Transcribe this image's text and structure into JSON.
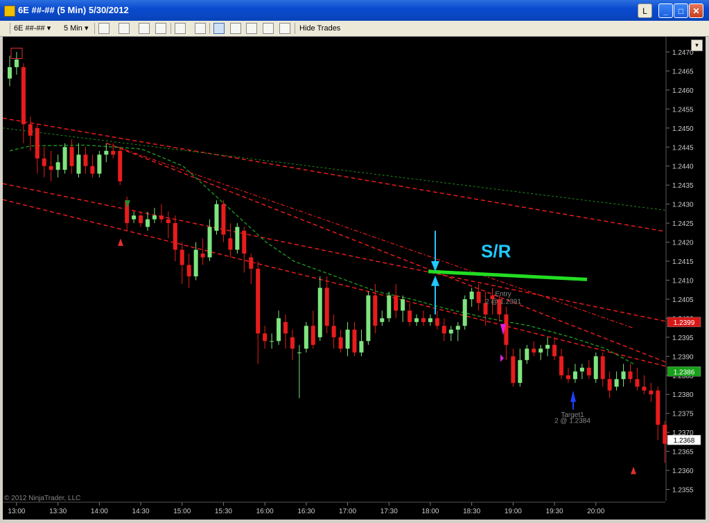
{
  "window": {
    "title": "6E ##-## (5 Min)  5/30/2012",
    "btn_l": "L",
    "btn_min": "_",
    "btn_max": "□",
    "btn_close": "✕"
  },
  "toolbar": {
    "instrument": "6E ##-##",
    "interval": "5 Min",
    "dropdown_glyph": "▾",
    "hide_trades_label": "Hide Trades",
    "icons": [
      "bar-type-icon",
      "draw-pencil-icon",
      "indicator-add-icon",
      "strategy-icon",
      "cursor-icon",
      "zoom-icon",
      "chart-trader-icon",
      "data-box-icon",
      "properties-icon",
      "alert-icon",
      "hide-icon"
    ]
  },
  "chart_data": {
    "type": "candlestick",
    "title": "",
    "ylim": [
      1.2352,
      1.2474
    ],
    "y_ticks": [
      "1.2470",
      "1.2465",
      "1.2460",
      "1.2455",
      "1.2450",
      "1.2445",
      "1.2440",
      "1.2435",
      "1.2430",
      "1.2425",
      "1.2420",
      "1.2415",
      "1.2410",
      "1.2405",
      "1.2400",
      "1.2395",
      "1.2390",
      "1.2385",
      "1.2380",
      "1.2375",
      "1.2370",
      "1.2365",
      "1.2360",
      "1.2355"
    ],
    "x_ticks": [
      "13:00",
      "13:30",
      "14:00",
      "14:30",
      "15:00",
      "15:30",
      "16:00",
      "16:30",
      "17:00",
      "17:30",
      "18:00",
      "18:30",
      "19:00",
      "19:30",
      "20:00"
    ],
    "x_start": "12:55",
    "bar_minutes": 5,
    "candles": [
      [
        1.2463,
        1.2469,
        1.2461,
        1.2466
      ],
      [
        1.2466,
        1.247,
        1.2464,
        1.2468
      ],
      [
        1.2466,
        1.2467,
        1.2446,
        1.2451
      ],
      [
        1.2451,
        1.2453,
        1.2444,
        1.2448
      ],
      [
        1.245,
        1.2451,
        1.2438,
        1.2442
      ],
      [
        1.2442,
        1.2445,
        1.2437,
        1.244
      ],
      [
        1.244,
        1.2444,
        1.2436,
        1.2439
      ],
      [
        1.2439,
        1.2443,
        1.2437,
        1.2441
      ],
      [
        1.2439,
        1.2446,
        1.2438,
        1.2445
      ],
      [
        1.2445,
        1.2447,
        1.2438,
        1.244
      ],
      [
        1.2438,
        1.2446,
        1.2437,
        1.2443
      ],
      [
        1.2443,
        1.2445,
        1.2438,
        1.244
      ],
      [
        1.244,
        1.2443,
        1.2437,
        1.2438
      ],
      [
        1.2438,
        1.2444,
        1.2437,
        1.2443
      ],
      [
        1.2443,
        1.2446,
        1.2441,
        1.2444
      ],
      [
        1.2444,
        1.2446,
        1.2442,
        1.2443
      ],
      [
        1.2444,
        1.2445,
        1.2435,
        1.2436
      ],
      [
        1.2431,
        1.2432,
        1.2423,
        1.2425
      ],
      [
        1.2426,
        1.2428,
        1.2425,
        1.2427
      ],
      [
        1.2427,
        1.2428,
        1.2424,
        1.2425
      ],
      [
        1.2424,
        1.2428,
        1.2423,
        1.2426
      ],
      [
        1.2426,
        1.2429,
        1.2425,
        1.2427
      ],
      [
        1.2427,
        1.243,
        1.2425,
        1.2426
      ],
      [
        1.2426,
        1.2428,
        1.2421,
        1.2425
      ],
      [
        1.2425,
        1.2427,
        1.2415,
        1.2418
      ],
      [
        1.2418,
        1.242,
        1.2409,
        1.2414
      ],
      [
        1.2414,
        1.2417,
        1.2408,
        1.2411
      ],
      [
        1.2411,
        1.242,
        1.241,
        1.2418
      ],
      [
        1.2417,
        1.2421,
        1.2414,
        1.2416
      ],
      [
        1.2416,
        1.2426,
        1.2415,
        1.2424
      ],
      [
        1.2423,
        1.2431,
        1.2422,
        1.243
      ],
      [
        1.243,
        1.2431,
        1.242,
        1.2422
      ],
      [
        1.2421,
        1.2425,
        1.2416,
        1.2418
      ],
      [
        1.2418,
        1.2425,
        1.2417,
        1.2424
      ],
      [
        1.2423,
        1.2424,
        1.2412,
        1.2417
      ],
      [
        1.2416,
        1.2417,
        1.2409,
        1.2413
      ],
      [
        1.2413,
        1.2415,
        1.2388,
        1.2396
      ],
      [
        1.2396,
        1.2398,
        1.2392,
        1.2394
      ],
      [
        1.2394,
        1.2396,
        1.2392,
        1.2394
      ],
      [
        1.2394,
        1.2402,
        1.2393,
        1.24
      ],
      [
        1.2399,
        1.2401,
        1.2392,
        1.2396
      ],
      [
        1.2395,
        1.2397,
        1.2389,
        1.2392
      ],
      [
        1.2391,
        1.2393,
        1.2379,
        1.2391
      ],
      [
        1.2392,
        1.2399,
        1.2391,
        1.2398
      ],
      [
        1.2398,
        1.2402,
        1.2392,
        1.2393
      ],
      [
        1.2395,
        1.2411,
        1.2394,
        1.2408
      ],
      [
        1.2408,
        1.2411,
        1.2396,
        1.2398
      ],
      [
        1.2398,
        1.2401,
        1.2392,
        1.2395
      ],
      [
        1.2395,
        1.2397,
        1.2391,
        1.2392
      ],
      [
        1.2392,
        1.2399,
        1.239,
        1.2397
      ],
      [
        1.2397,
        1.2399,
        1.239,
        1.2391
      ],
      [
        1.2391,
        1.2397,
        1.239,
        1.2394
      ],
      [
        1.2394,
        1.2407,
        1.2393,
        1.2406
      ],
      [
        1.2406,
        1.2409,
        1.2396,
        1.2398
      ],
      [
        1.2399,
        1.2402,
        1.2398,
        1.24
      ],
      [
        1.24,
        1.2407,
        1.2399,
        1.2406
      ],
      [
        1.2406,
        1.2409,
        1.24,
        1.2402
      ],
      [
        1.2402,
        1.2406,
        1.2399,
        1.2405
      ],
      [
        1.2402,
        1.2404,
        1.2398,
        1.2399
      ],
      [
        1.2399,
        1.2401,
        1.2398,
        1.24
      ],
      [
        1.24,
        1.2402,
        1.2398,
        1.2399
      ],
      [
        1.2399,
        1.2401,
        1.2398,
        1.24
      ],
      [
        1.24,
        1.2402,
        1.2397,
        1.2398
      ],
      [
        1.2398,
        1.24,
        1.2394,
        1.2396
      ],
      [
        1.2396,
        1.2398,
        1.2394,
        1.2397
      ],
      [
        1.2397,
        1.2399,
        1.2394,
        1.2398
      ],
      [
        1.2398,
        1.2406,
        1.2397,
        1.2405
      ],
      [
        1.2405,
        1.2408,
        1.2403,
        1.2407
      ],
      [
        1.2407,
        1.2409,
        1.2402,
        1.2404
      ],
      [
        1.2404,
        1.2407,
        1.2398,
        1.2401
      ],
      [
        1.2406,
        1.2408,
        1.2401,
        1.2405
      ],
      [
        1.2405,
        1.2406,
        1.2399,
        1.2401
      ],
      [
        1.2401,
        1.2403,
        1.2389,
        1.2393
      ],
      [
        1.239,
        1.2392,
        1.2382,
        1.2383
      ],
      [
        1.2383,
        1.2392,
        1.2382,
        1.2389
      ],
      [
        1.2389,
        1.2393,
        1.2388,
        1.2392
      ],
      [
        1.2392,
        1.2394,
        1.239,
        1.2391
      ],
      [
        1.2391,
        1.2393,
        1.2389,
        1.2392
      ],
      [
        1.2392,
        1.2395,
        1.239,
        1.2393
      ],
      [
        1.2393,
        1.2395,
        1.2389,
        1.239
      ],
      [
        1.239,
        1.2392,
        1.2384,
        1.2385
      ],
      [
        1.2385,
        1.2387,
        1.2383,
        1.2384
      ],
      [
        1.2384,
        1.2388,
        1.2383,
        1.2386
      ],
      [
        1.2386,
        1.2388,
        1.2384,
        1.2387
      ],
      [
        1.2387,
        1.2389,
        1.2384,
        1.2385
      ],
      [
        1.2384,
        1.2391,
        1.2383,
        1.239
      ],
      [
        1.239,
        1.2391,
        1.2382,
        1.2384
      ],
      [
        1.2384,
        1.2386,
        1.2379,
        1.2381
      ],
      [
        1.2382,
        1.2386,
        1.2381,
        1.2384
      ],
      [
        1.2384,
        1.2388,
        1.2382,
        1.2386
      ],
      [
        1.2386,
        1.2388,
        1.2383,
        1.2384
      ],
      [
        1.2384,
        1.2387,
        1.2381,
        1.2382
      ],
      [
        1.2382,
        1.2385,
        1.238,
        1.2381
      ],
      [
        1.2381,
        1.2383,
        1.2378,
        1.238
      ],
      [
        1.2381,
        1.2382,
        1.2368,
        1.2372
      ],
      [
        1.2372,
        1.2373,
        1.2362,
        1.2367
      ]
    ],
    "price_marker_red": "1.2399",
    "price_marker_green": "1.2386",
    "price_marker_last": "1.2368",
    "annotations": {
      "sr_label": "S/R",
      "entry_label": "Entry",
      "entry_detail": "2 @ 1.2391",
      "target_label": "Target1",
      "target_detail": "2 @ 1.2384"
    },
    "copyright": "© 2012 NinjaTrader, LLC",
    "colors": {
      "up": "#7fe47f",
      "down": "#e81c1c",
      "trend": "#e81c1c",
      "ma": "#1e8a1e",
      "sr": "#22dd22",
      "sr_text": "#20c8ff",
      "arrow": "#20c8ff"
    }
  }
}
